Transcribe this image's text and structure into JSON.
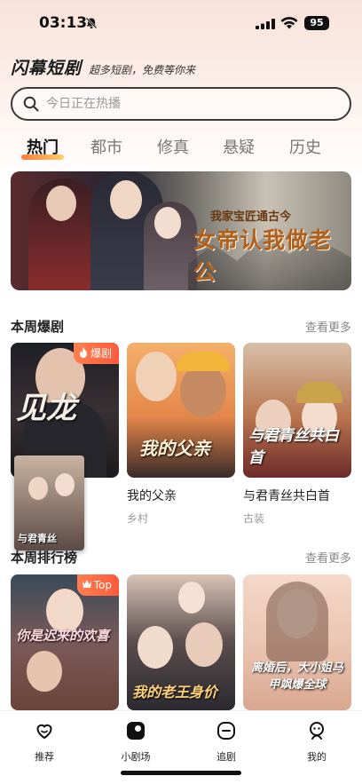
{
  "status_bar": {
    "time": "03:13",
    "battery": "95"
  },
  "app": {
    "title": "闪幕短剧",
    "slogan": "超多短剧，免费等你来"
  },
  "search": {
    "placeholder": "今日正在热播"
  },
  "tabs": [
    {
      "label": "热门",
      "active": true
    },
    {
      "label": "都市",
      "active": false
    },
    {
      "label": "修真",
      "active": false
    },
    {
      "label": "悬疑",
      "active": false
    },
    {
      "label": "历史",
      "active": false
    }
  ],
  "banner": {
    "subtitle": "我家宝匠通古今",
    "title": "女帝认我做老公"
  },
  "weekly_hits": {
    "title": "本周爆剧",
    "more": "查看更多",
    "items": [
      {
        "poster_text": "见龙",
        "badge": "爆剧"
      },
      {
        "poster_text": "我的父亲",
        "name": "我的父亲",
        "genre": "乡村"
      },
      {
        "poster_text": "与君青丝共白首",
        "name": "与君青丝共白首",
        "genre": "古装"
      }
    ]
  },
  "floating_mini": {
    "title": "与君青丝"
  },
  "weekly_rank": {
    "title": "本周排行榜",
    "more": "查看更多",
    "items": [
      {
        "poster_text": "你是迟来的欢喜",
        "badge": "Top"
      },
      {
        "poster_text": "我的老王身价"
      },
      {
        "poster_text": "离婚后，大小姐马甲飒爆全球"
      }
    ]
  },
  "tabbar": [
    {
      "label": "推荐",
      "icon": "heart-icon"
    },
    {
      "label": "小剧场",
      "icon": "theater-icon"
    },
    {
      "label": "追剧",
      "icon": "follow-icon"
    },
    {
      "label": "我的",
      "icon": "profile-icon"
    }
  ]
}
